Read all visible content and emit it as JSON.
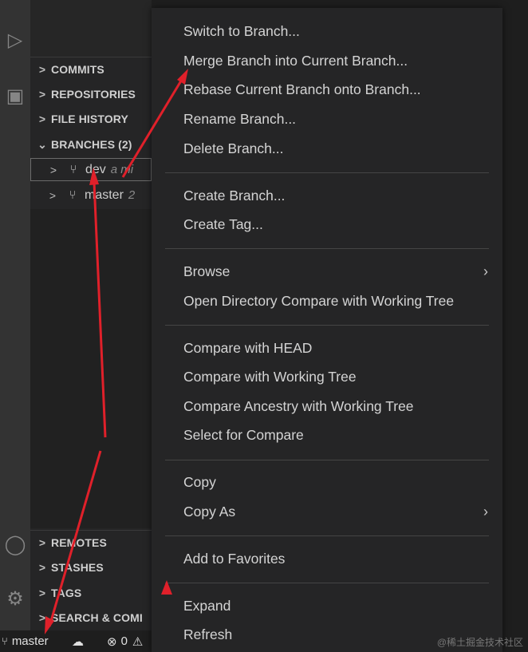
{
  "sidebar": {
    "sections_top": [
      {
        "label": "COMMITS"
      },
      {
        "label": "REPOSITORIES"
      },
      {
        "label": "FILE HISTORY"
      },
      {
        "label": "BRANCHES (2)"
      }
    ],
    "branches": [
      {
        "name": "dev",
        "desc": "a mi"
      },
      {
        "name": "master",
        "desc": "2"
      }
    ],
    "sections_bottom": [
      {
        "label": "REMOTES"
      },
      {
        "label": "STASHES"
      },
      {
        "label": "TAGS"
      },
      {
        "label": "SEARCH & COMI"
      }
    ]
  },
  "statusbar": {
    "branch": "master",
    "errors": "0"
  },
  "menu": {
    "groups": [
      [
        "Switch to Branch...",
        "Merge Branch into Current Branch...",
        "Rebase Current Branch onto Branch...",
        "Rename Branch...",
        "Delete Branch..."
      ],
      [
        "Create Branch...",
        "Create Tag..."
      ],
      [
        "Browse",
        "Open Directory Compare with Working Tree"
      ],
      [
        "Compare with HEAD",
        "Compare with Working Tree",
        "Compare Ancestry with Working Tree",
        "Select for Compare"
      ],
      [
        "Copy",
        "Copy As"
      ],
      [
        "Add to Favorites"
      ],
      [
        "Expand",
        "Refresh"
      ]
    ],
    "submenu_indicator": "›"
  },
  "watermark": "@稀土掘金技术社区",
  "colors": {
    "annotation": "#e0202a",
    "menu_bg": "#252526",
    "sidebar_bg": "#252526"
  }
}
